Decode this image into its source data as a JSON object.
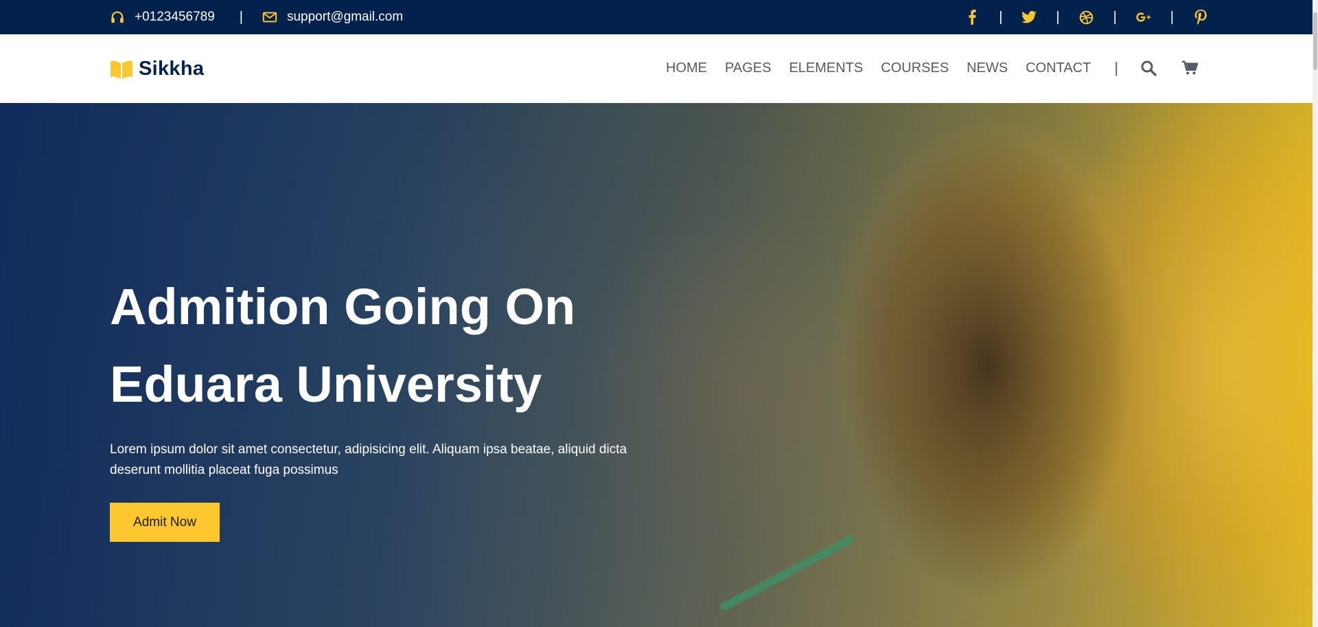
{
  "topbar": {
    "phone": "+0123456789",
    "email": "support@gmail.com",
    "separator": "|",
    "social": [
      "facebook-icon",
      "twitter-icon",
      "dribbble-icon",
      "google-plus-icon",
      "pinterest-icon"
    ]
  },
  "header": {
    "logo_text": "Sikkha",
    "nav": [
      "HOME",
      "PAGES",
      "ELEMENTS",
      "COURSES",
      "NEWS",
      "CONTACT"
    ],
    "nav_separator": "|"
  },
  "hero": {
    "title_line1": "Admition Going On",
    "title_line2": "Eduara University",
    "description": "Lorem ipsum dolor sit amet consectetur, adipisicing elit. Aliquam ipsa beatae, aliquid dicta deserunt mollitia placeat fuga possimus",
    "button_label": "Admit Now"
  },
  "colors": {
    "topbar_bg": "#03214d",
    "accent": "#fdc730",
    "nav_text": "#555a64",
    "logo_text": "#03214d"
  }
}
